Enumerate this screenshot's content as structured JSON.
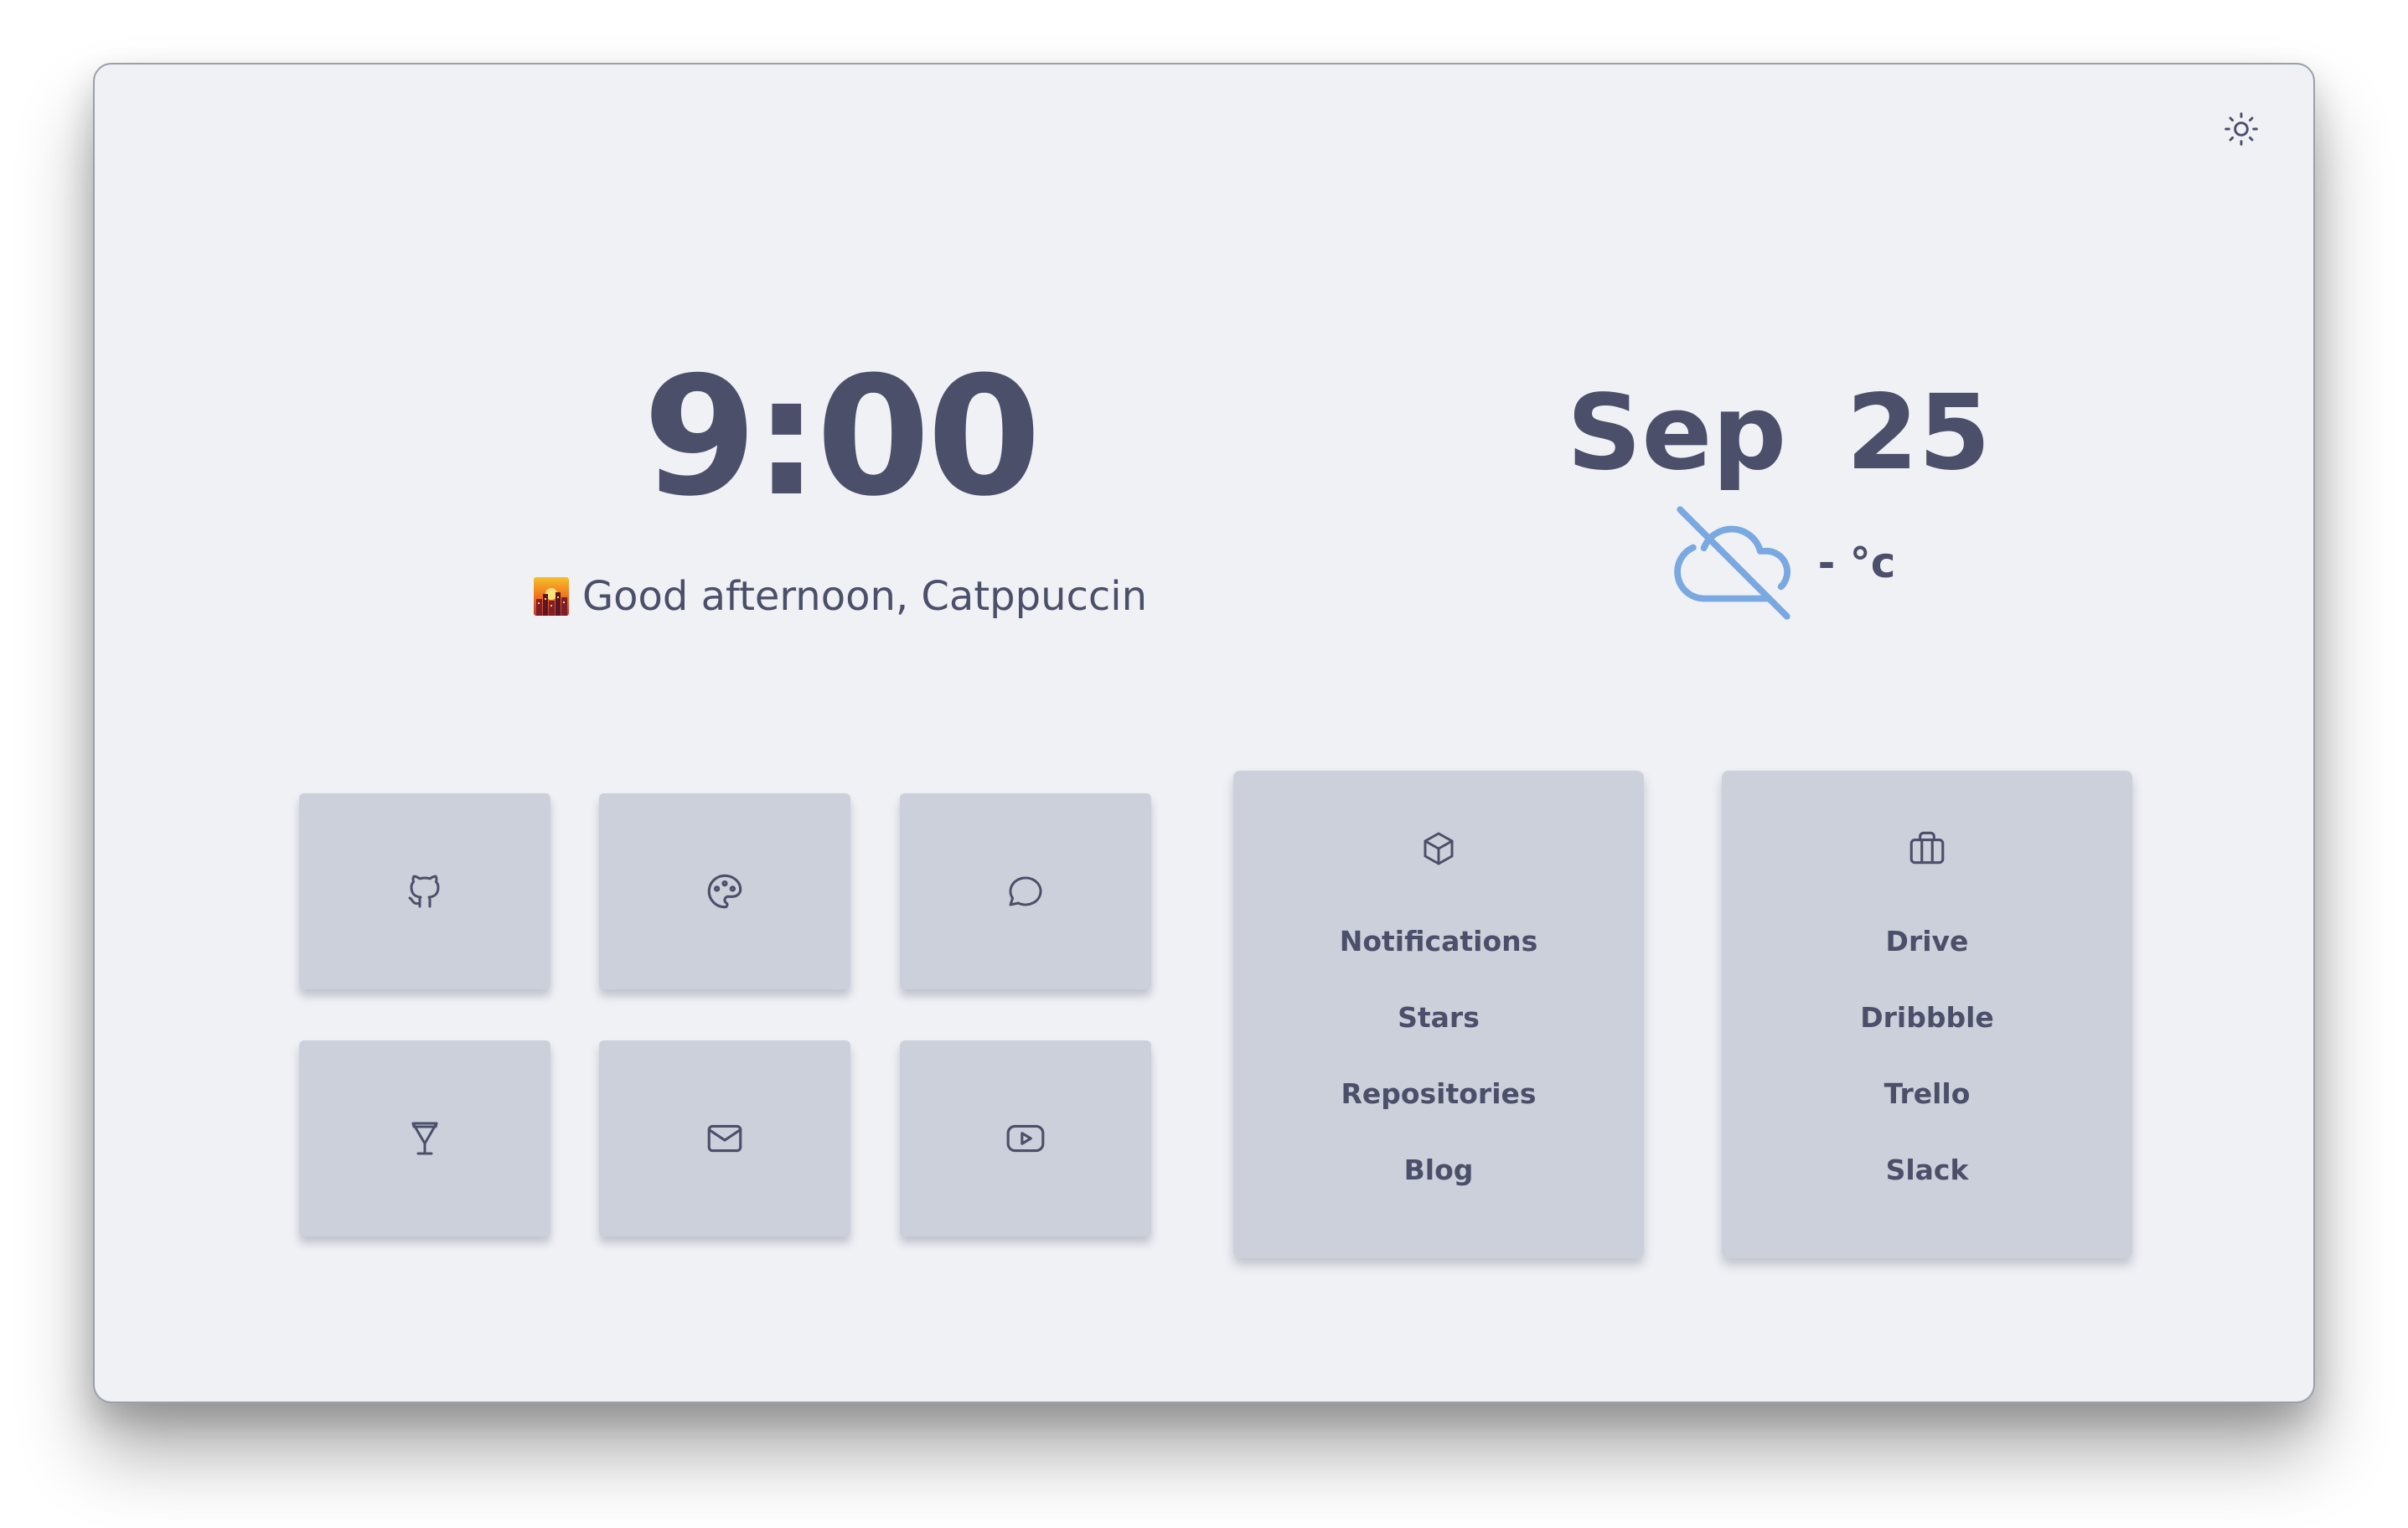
{
  "clock": {
    "time": "9:00"
  },
  "greeting": {
    "text": "Good afternoon, Catppuccin",
    "icon": "cityscape-sunset-icon"
  },
  "date": {
    "text": "Sep 25"
  },
  "weather": {
    "icon": "cloud-off-icon",
    "temperature": "- °c",
    "icon_color": "#7aa8e0"
  },
  "theme_toggle": {
    "icon": "sun-icon"
  },
  "colors": {
    "background": "#eff1f5",
    "tile": "#ccd0da",
    "text": "#4c4f69"
  },
  "tiles": [
    {
      "icon": "github-icon"
    },
    {
      "icon": "palette-icon"
    },
    {
      "icon": "chat-bubble-icon"
    },
    {
      "icon": "martini-glass-icon"
    },
    {
      "icon": "mail-icon"
    },
    {
      "icon": "youtube-icon"
    }
  ],
  "link_cards": [
    {
      "icon": "box-icon",
      "links": [
        "Notifications",
        "Stars",
        "Repositories",
        "Blog"
      ]
    },
    {
      "icon": "briefcase-icon",
      "links": [
        "Drive",
        "Dribbble",
        "Trello",
        "Slack"
      ]
    }
  ]
}
